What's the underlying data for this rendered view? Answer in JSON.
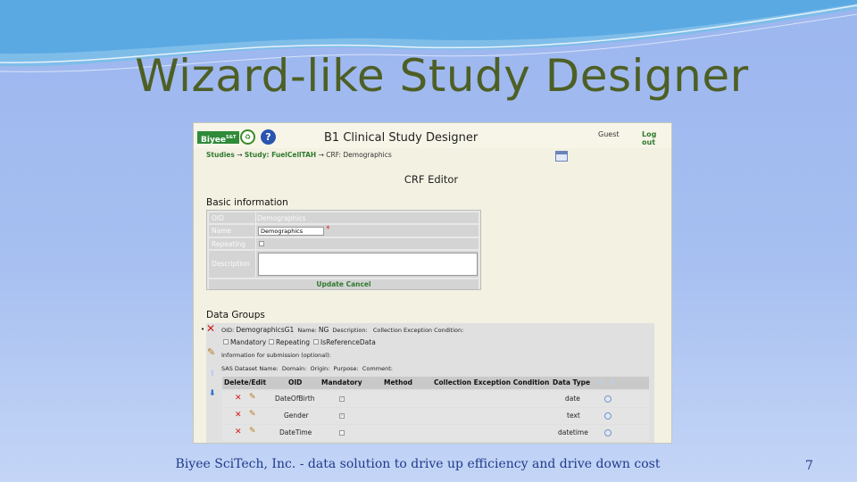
{
  "slide": {
    "title": "Wizard-like Study Designer",
    "footer": "Biyee SciTech, Inc. - data solution to drive up efficiency and drive down cost",
    "page_number": "7"
  },
  "app": {
    "logo_text": "Biyee",
    "logo_sup": "S&T",
    "help_glyph": "?",
    "title": "B1 Clinical Study Designer",
    "user": "Guest",
    "logout_label": "Log out"
  },
  "breadcrumb": {
    "studies": "Studies",
    "arrow1": "→",
    "study": "Study: FuelCellTAH",
    "arrow2": "→",
    "current": "CRF: Demographics"
  },
  "editor_title": "CRF Editor",
  "basic_info": {
    "heading": "Basic information",
    "oid_label": "OID",
    "oid_value": "Demographics",
    "name_label": "Name",
    "name_value": "Demographics",
    "required_mark": "*",
    "repeating_label": "Repeating",
    "description_label": "Description",
    "update_label": "Update",
    "cancel_label": "Cancel"
  },
  "data_groups": {
    "heading": "Data Groups",
    "bullet": "•",
    "delete_glyph": "✕",
    "oid_label": "OID:",
    "oid_value": "DemographicsG1",
    "name_label": "Name:",
    "name_value": "NG",
    "description_label": "Description:",
    "collection_exception_label": "Collection Exception Condition:",
    "mandatory_label": "Mandatory",
    "repeating_label": "Repeating",
    "is_reference_label": "IsReferenceData",
    "submission_info": "Information for submission (optional):",
    "sas_dataset_label": "SAS Dataset Name:",
    "domain_label": "Domain:",
    "origin_label": "Origin:",
    "purpose_label": "Purpose:",
    "comment_label": "Comment:",
    "columns": [
      "Delete/Edit",
      "OID",
      "Mandatory",
      "Method",
      "Collection Exception Condition",
      "Data Type"
    ],
    "rows": [
      {
        "oid": "DateOfBirth",
        "mandatory": true,
        "data_type": "date"
      },
      {
        "oid": "Gender",
        "mandatory": true,
        "data_type": "text"
      },
      {
        "oid": "DateTime",
        "mandatory": false,
        "data_type": "datetime"
      }
    ]
  },
  "icons": {
    "delete": "delete-x-icon",
    "edit": "pencil-icon",
    "move_up": "arrow-up-icon",
    "move_down": "arrow-down-icon",
    "calendar": "calendar-icon"
  },
  "colors": {
    "title_green": "#4e5f25",
    "link_green": "#2f7a2f",
    "footer_blue": "#1f3b8c",
    "delete_red": "#d01818"
  }
}
